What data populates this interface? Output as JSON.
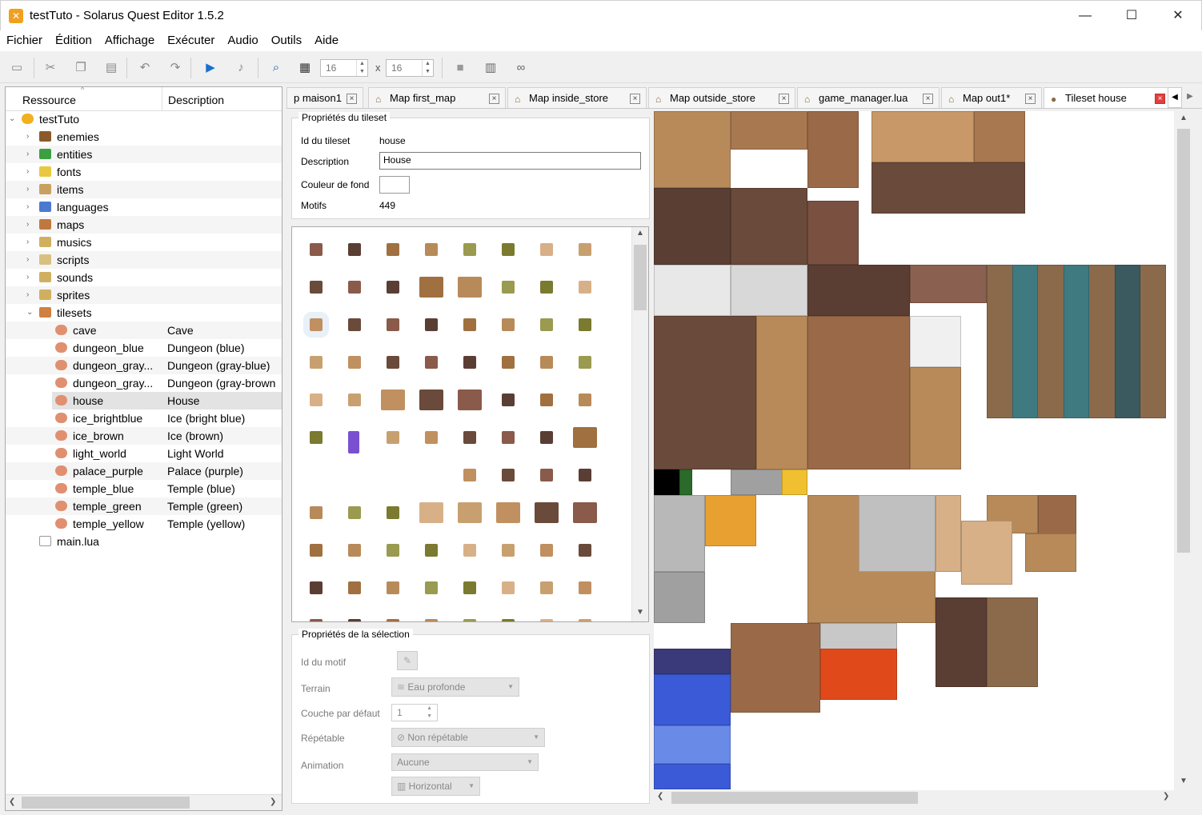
{
  "window": {
    "title": "testTuto - Solarus Quest Editor 1.5.2",
    "minimize": "—",
    "maximize": "☐",
    "close": "✕"
  },
  "menu": [
    "Fichier",
    "Édition",
    "Affichage",
    "Exécuter",
    "Audio",
    "Outils",
    "Aide"
  ],
  "toolbar": {
    "grid_w": "16",
    "grid_sep": "x",
    "grid_h": "16"
  },
  "tree": {
    "col_resource": "Ressource",
    "col_description": "Description",
    "root": "testTuto",
    "folders": [
      "enemies",
      "entities",
      "fonts",
      "items",
      "languages",
      "maps",
      "musics",
      "scripts",
      "sounds",
      "sprites",
      "tilesets"
    ],
    "tilesets": [
      {
        "name": "cave",
        "desc": "Cave"
      },
      {
        "name": "dungeon_blue",
        "desc": "Dungeon (blue)"
      },
      {
        "name": "dungeon_gray...",
        "desc": "Dungeon (gray-blue)"
      },
      {
        "name": "dungeon_gray...",
        "desc": "Dungeon (gray-brown"
      },
      {
        "name": "house",
        "desc": "House"
      },
      {
        "name": "ice_brightblue",
        "desc": "Ice (bright blue)"
      },
      {
        "name": "ice_brown",
        "desc": "Ice (brown)"
      },
      {
        "name": "light_world",
        "desc": "Light World"
      },
      {
        "name": "palace_purple",
        "desc": "Palace (purple)"
      },
      {
        "name": "temple_blue",
        "desc": "Temple (blue)"
      },
      {
        "name": "temple_green",
        "desc": "Temple (green)"
      },
      {
        "name": "temple_yellow",
        "desc": "Temple (yellow)"
      }
    ],
    "main_file": "main.lua",
    "selected": "house"
  },
  "tabs": [
    {
      "label": "p maison1",
      "icon": false
    },
    {
      "label": "Map first_map",
      "icon": true
    },
    {
      "label": "Map inside_store",
      "icon": true
    },
    {
      "label": "Map outside_store",
      "icon": true
    },
    {
      "label": "game_manager.lua",
      "icon": true
    },
    {
      "label": "Map out1*",
      "icon": true
    },
    {
      "label": "Tileset house",
      "icon": true,
      "active": true
    }
  ],
  "tileset_props": {
    "group_title": "Propriétés du tileset",
    "id_label": "Id du tileset",
    "id_value": "house",
    "desc_label": "Description",
    "desc_value": "House",
    "bg_label": "Couleur de fond",
    "patterns_label": "Motifs",
    "patterns_value": "449"
  },
  "selection_props": {
    "group_title": "Propriétés de la sélection",
    "pattern_id_label": "Id du motif",
    "terrain_label": "Terrain",
    "terrain_value": "Eau profonde",
    "layer_label": "Couche par défaut",
    "layer_value": "1",
    "repeat_label": "Répétable",
    "repeat_value": "Non répétable",
    "animation_label": "Animation",
    "animation_value": "Aucune",
    "animation_dir": "Horizontal"
  },
  "colors": {
    "accent": "#0078d7",
    "wood": "#b88a5a",
    "dark_wood": "#5a3e34",
    "teal": "#3e7a80",
    "water": "#3a5ad8",
    "lava": "#e04a1a"
  }
}
